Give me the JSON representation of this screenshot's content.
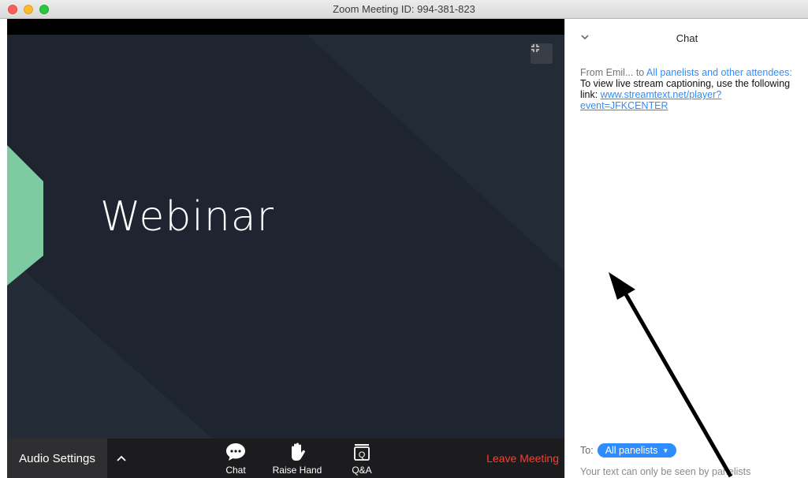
{
  "window": {
    "title": "Zoom Meeting ID: 994-381-823"
  },
  "slide": {
    "title": "Webinar"
  },
  "toolbar": {
    "audio_settings": "Audio Settings",
    "chat": "Chat",
    "raise_hand": "Raise Hand",
    "qa": "Q&A",
    "leave": "Leave Meeting"
  },
  "chat": {
    "title": "Chat",
    "message": {
      "from_prefix": "From Emil... to ",
      "recipient": "All panelists and other attendees:",
      "text": "To view live stream captioning, use the following link: ",
      "link": "www.streamtext.net/player?event=JFKCENTER"
    },
    "to_label": "To:",
    "to_value": "All panelists",
    "input_placeholder": "Your text can only be seen by panelists"
  },
  "colors": {
    "accent": "#2d8cff",
    "leave": "#ff3b30",
    "slide_bg": "#1e2530",
    "slide_accent": "#7ecba1"
  }
}
